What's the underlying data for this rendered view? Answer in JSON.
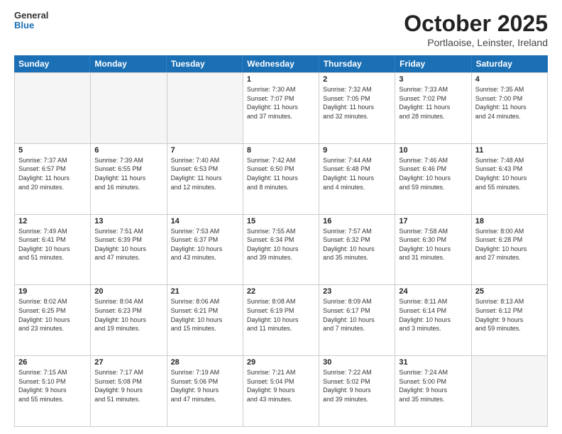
{
  "logo": {
    "text_general": "General",
    "text_blue": "Blue"
  },
  "header": {
    "month": "October 2025",
    "location": "Portlaoise, Leinster, Ireland"
  },
  "weekdays": [
    "Sunday",
    "Monday",
    "Tuesday",
    "Wednesday",
    "Thursday",
    "Friday",
    "Saturday"
  ],
  "weeks": [
    [
      {
        "day": "",
        "info": ""
      },
      {
        "day": "",
        "info": ""
      },
      {
        "day": "",
        "info": ""
      },
      {
        "day": "1",
        "info": "Sunrise: 7:30 AM\nSunset: 7:07 PM\nDaylight: 11 hours\nand 37 minutes."
      },
      {
        "day": "2",
        "info": "Sunrise: 7:32 AM\nSunset: 7:05 PM\nDaylight: 11 hours\nand 32 minutes."
      },
      {
        "day": "3",
        "info": "Sunrise: 7:33 AM\nSunset: 7:02 PM\nDaylight: 11 hours\nand 28 minutes."
      },
      {
        "day": "4",
        "info": "Sunrise: 7:35 AM\nSunset: 7:00 PM\nDaylight: 11 hours\nand 24 minutes."
      }
    ],
    [
      {
        "day": "5",
        "info": "Sunrise: 7:37 AM\nSunset: 6:57 PM\nDaylight: 11 hours\nand 20 minutes."
      },
      {
        "day": "6",
        "info": "Sunrise: 7:39 AM\nSunset: 6:55 PM\nDaylight: 11 hours\nand 16 minutes."
      },
      {
        "day": "7",
        "info": "Sunrise: 7:40 AM\nSunset: 6:53 PM\nDaylight: 11 hours\nand 12 minutes."
      },
      {
        "day": "8",
        "info": "Sunrise: 7:42 AM\nSunset: 6:50 PM\nDaylight: 11 hours\nand 8 minutes."
      },
      {
        "day": "9",
        "info": "Sunrise: 7:44 AM\nSunset: 6:48 PM\nDaylight: 11 hours\nand 4 minutes."
      },
      {
        "day": "10",
        "info": "Sunrise: 7:46 AM\nSunset: 6:46 PM\nDaylight: 10 hours\nand 59 minutes."
      },
      {
        "day": "11",
        "info": "Sunrise: 7:48 AM\nSunset: 6:43 PM\nDaylight: 10 hours\nand 55 minutes."
      }
    ],
    [
      {
        "day": "12",
        "info": "Sunrise: 7:49 AM\nSunset: 6:41 PM\nDaylight: 10 hours\nand 51 minutes."
      },
      {
        "day": "13",
        "info": "Sunrise: 7:51 AM\nSunset: 6:39 PM\nDaylight: 10 hours\nand 47 minutes."
      },
      {
        "day": "14",
        "info": "Sunrise: 7:53 AM\nSunset: 6:37 PM\nDaylight: 10 hours\nand 43 minutes."
      },
      {
        "day": "15",
        "info": "Sunrise: 7:55 AM\nSunset: 6:34 PM\nDaylight: 10 hours\nand 39 minutes."
      },
      {
        "day": "16",
        "info": "Sunrise: 7:57 AM\nSunset: 6:32 PM\nDaylight: 10 hours\nand 35 minutes."
      },
      {
        "day": "17",
        "info": "Sunrise: 7:58 AM\nSunset: 6:30 PM\nDaylight: 10 hours\nand 31 minutes."
      },
      {
        "day": "18",
        "info": "Sunrise: 8:00 AM\nSunset: 6:28 PM\nDaylight: 10 hours\nand 27 minutes."
      }
    ],
    [
      {
        "day": "19",
        "info": "Sunrise: 8:02 AM\nSunset: 6:25 PM\nDaylight: 10 hours\nand 23 minutes."
      },
      {
        "day": "20",
        "info": "Sunrise: 8:04 AM\nSunset: 6:23 PM\nDaylight: 10 hours\nand 19 minutes."
      },
      {
        "day": "21",
        "info": "Sunrise: 8:06 AM\nSunset: 6:21 PM\nDaylight: 10 hours\nand 15 minutes."
      },
      {
        "day": "22",
        "info": "Sunrise: 8:08 AM\nSunset: 6:19 PM\nDaylight: 10 hours\nand 11 minutes."
      },
      {
        "day": "23",
        "info": "Sunrise: 8:09 AM\nSunset: 6:17 PM\nDaylight: 10 hours\nand 7 minutes."
      },
      {
        "day": "24",
        "info": "Sunrise: 8:11 AM\nSunset: 6:14 PM\nDaylight: 10 hours\nand 3 minutes."
      },
      {
        "day": "25",
        "info": "Sunrise: 8:13 AM\nSunset: 6:12 PM\nDaylight: 9 hours\nand 59 minutes."
      }
    ],
    [
      {
        "day": "26",
        "info": "Sunrise: 7:15 AM\nSunset: 5:10 PM\nDaylight: 9 hours\nand 55 minutes."
      },
      {
        "day": "27",
        "info": "Sunrise: 7:17 AM\nSunset: 5:08 PM\nDaylight: 9 hours\nand 51 minutes."
      },
      {
        "day": "28",
        "info": "Sunrise: 7:19 AM\nSunset: 5:06 PM\nDaylight: 9 hours\nand 47 minutes."
      },
      {
        "day": "29",
        "info": "Sunrise: 7:21 AM\nSunset: 5:04 PM\nDaylight: 9 hours\nand 43 minutes."
      },
      {
        "day": "30",
        "info": "Sunrise: 7:22 AM\nSunset: 5:02 PM\nDaylight: 9 hours\nand 39 minutes."
      },
      {
        "day": "31",
        "info": "Sunrise: 7:24 AM\nSunset: 5:00 PM\nDaylight: 9 hours\nand 35 minutes."
      },
      {
        "day": "",
        "info": ""
      }
    ]
  ]
}
